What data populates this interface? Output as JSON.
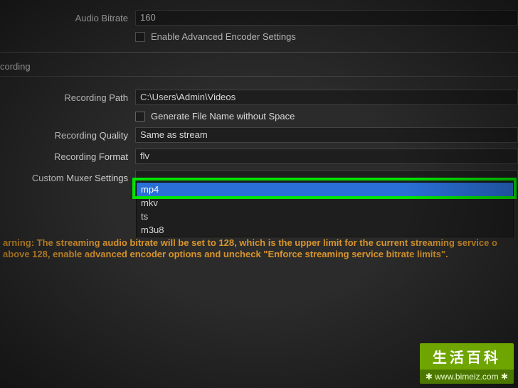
{
  "audio": {
    "bitrate_label": "Audio Bitrate",
    "bitrate_value": "160",
    "enable_advanced_label": "Enable Advanced Encoder Settings"
  },
  "recording": {
    "section_title": "cording",
    "path_label": "Recording Path",
    "path_value": "C:\\Users\\Admin\\Videos",
    "generate_no_space_label": "Generate File Name without Space",
    "quality_label": "Recording Quality",
    "quality_value": "Same as stream",
    "format_label": "Recording Format",
    "format_value": "flv",
    "muxer_label": "Custom Muxer Settings",
    "format_options": [
      "mp4",
      "mkv",
      "ts",
      "m3u8"
    ],
    "format_selected_index": 0
  },
  "warning_text": "arning: The streaming audio bitrate will be set to 128, which is the upper limit for the current streaming service o above 128, enable advanced encoder options and uncheck \"Enforce streaming service bitrate limits\".",
  "watermark": {
    "title": "生活百科",
    "url": "www.bimeiz.com"
  }
}
